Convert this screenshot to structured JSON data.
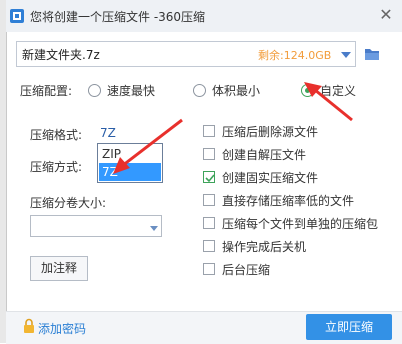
{
  "window": {
    "title": "您将创建一个压缩文件 -360压缩"
  },
  "path": {
    "filename": "新建文件夹.7z",
    "free_space": "剩余:124.0GB"
  },
  "config": {
    "label": "压缩配置:",
    "options": [
      {
        "label": "速度最快",
        "selected": false
      },
      {
        "label": "体积最小",
        "selected": false
      },
      {
        "label": "自定义",
        "selected": true
      }
    ]
  },
  "format": {
    "label": "压缩格式:",
    "value": "7Z",
    "dropdown_options": [
      {
        "label": "ZIP",
        "highlighted": false
      },
      {
        "label": "7Z",
        "highlighted": true
      }
    ]
  },
  "method": {
    "label": "压缩方式:"
  },
  "split": {
    "label": "压缩分卷大小:",
    "value": ""
  },
  "annotate_button": "加注释",
  "options": [
    {
      "label": "压缩后删除源文件",
      "checked": false
    },
    {
      "label": "创建自解压文件",
      "checked": false
    },
    {
      "label": "创建固实压缩文件",
      "checked": true
    },
    {
      "label": "直接存储压缩率低的文件",
      "checked": false
    },
    {
      "label": "压缩每个文件到单独的压缩包",
      "checked": false
    },
    {
      "label": "操作完成后关机",
      "checked": false
    },
    {
      "label": "后台压缩",
      "checked": false
    }
  ],
  "footer": {
    "add_password": "添加密码",
    "compress_button": "立即压缩"
  },
  "colors": {
    "accent": "#3391e6",
    "green": "#3da35a",
    "orange": "#f29c3b",
    "arrow": "#e8302c"
  }
}
